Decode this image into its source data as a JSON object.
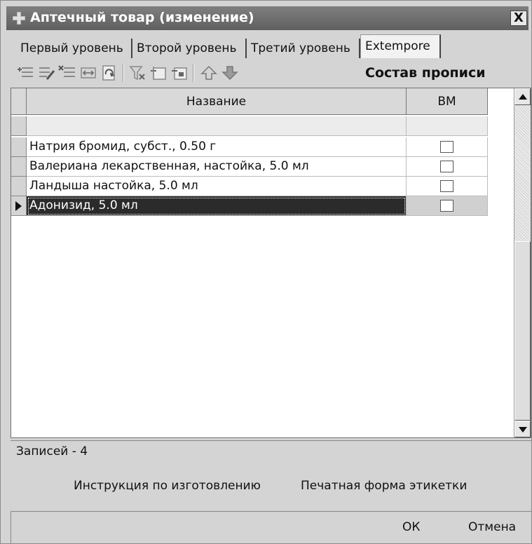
{
  "window": {
    "title": "Аптечный товар (изменение)",
    "close_label": "X"
  },
  "tabs": [
    {
      "label": "Первый уровень",
      "active": false
    },
    {
      "label": "Второй уровень",
      "active": false
    },
    {
      "label": "Третий уровень",
      "active": false
    },
    {
      "label": "Extempore",
      "active": true
    }
  ],
  "toolbar": {
    "title": "Состав прописи",
    "icons": [
      "add-row-icon",
      "edit-row-icon",
      "delete-row-icon",
      "resize-columns-icon",
      "refresh-icon",
      "clear-filter-icon",
      "filter-icon",
      "filter-apply-icon",
      "move-up-icon",
      "move-down-icon"
    ]
  },
  "grid": {
    "columns": [
      "Название",
      "ВМ"
    ],
    "rows": [
      {
        "name": "",
        "vm": false,
        "empty": true
      },
      {
        "name": "Натрия бромид, субст., 0.50 г",
        "vm": false
      },
      {
        "name": "Валериана лекарственная, настойка, 5.0 мл",
        "vm": false
      },
      {
        "name": "Ландыша настойка, 5.0 мл",
        "vm": false
      },
      {
        "name": "Адонизид, 5.0 мл",
        "vm": false,
        "selected": true
      }
    ]
  },
  "status": {
    "records": "Записей - 4"
  },
  "actions": {
    "instruction": "Инструкция по изготовлению",
    "label_print": "Печатная форма этикетки"
  },
  "buttons": {
    "ok": "ОК",
    "cancel": "Отмена"
  },
  "colors": {
    "selection": "#2b2b2b",
    "titlebar": "#6f6f6f"
  }
}
